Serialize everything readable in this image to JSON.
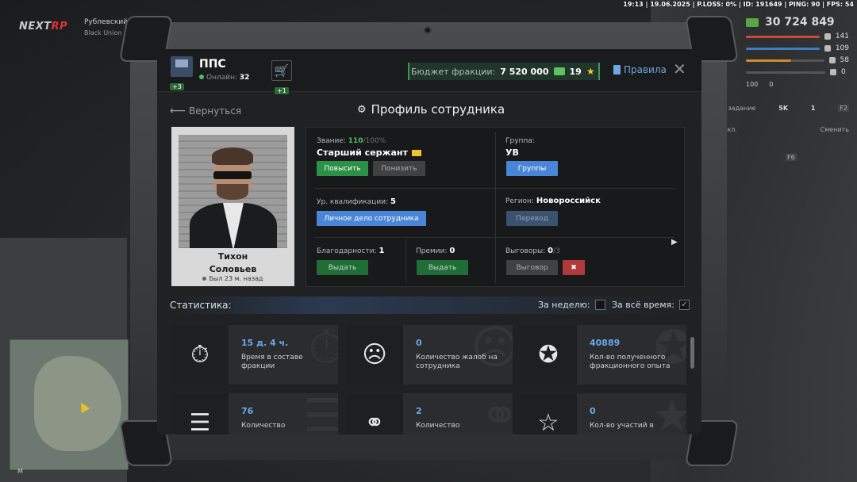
{
  "debug": "19:13 | 19.06.2025 | P.LOSS: 0% | ID: 191649 | PING: 90 | FPS: 54",
  "logo": {
    "main": "NEXT",
    "accent": "RP"
  },
  "location": {
    "district": "Рублевский",
    "street": "Black Union"
  },
  "hud": {
    "money": "30 724 849",
    "bars": [
      {
        "value": "141",
        "percent": 100,
        "color": "#c74a3c"
      },
      {
        "value": "109",
        "percent": 100,
        "color": "#3e7dc4"
      },
      {
        "value": "58",
        "percent": 58,
        "color": "#d38a2f"
      },
      {
        "value": "0",
        "percent": 0,
        "color": "#888888"
      }
    ],
    "extra_left": "100",
    "extra_right": "0",
    "task": "е задание",
    "cash_small": "5K",
    "coins_small": "1",
    "key_f2": "F2",
    "off_label": "ыкл.",
    "change_label": "Сменить",
    "key_f6": "F6"
  },
  "map_label": "M",
  "header": {
    "org_name": "ППС",
    "org_badge": "+3",
    "online_label": "Онлайн:",
    "online_count": "32",
    "cart_badge": "+1",
    "budget_label": "Бюджет фракции:",
    "budget_value": "7 520 000",
    "stars_value": "19",
    "rules_label": "Правила",
    "close_icon": "✕"
  },
  "nav": {
    "back_label": "Вернуться",
    "title": "Профиль сотрудника"
  },
  "profile": {
    "first_name": "Тихон",
    "last_name": "Соловьев",
    "last_seen": "Был 23 м. назад"
  },
  "info": {
    "rank_label": "Звание:",
    "rank_current": "110",
    "rank_max": "/100%",
    "rank_name": "Старший сержант",
    "btn_promote": "Повысить",
    "btn_demote": "Понизить",
    "group_label": "Группа:",
    "group_value": "УВ",
    "btn_groups": "Группы",
    "qual_label": "Ур. квалификации:",
    "qual_value": "5",
    "btn_personal_file": "Личное дело сотрудника",
    "region_label": "Регион:",
    "region_value": "Новороссийск",
    "btn_transfer": "Перевод",
    "thanks_label": "Благодарности:",
    "thanks_value": "1",
    "btn_give_thanks": "Выдать",
    "bonus_label": "Премии:",
    "bonus_value": "0",
    "btn_give_bonus": "Выдать",
    "reprimand_label": "Выговоры:",
    "reprimand_value": "0",
    "reprimand_max": "/3",
    "btn_reprimand": "Выговор"
  },
  "stats": {
    "heading": "Статистика:",
    "week_label": "За неделю:",
    "week_checked": false,
    "alltime_label": "За всё время:",
    "alltime_checked": true,
    "cards": [
      {
        "value": "15 д. 4 ч.",
        "label": "Время в составе фракции",
        "icon": "stopwatch-icon"
      },
      {
        "value": "0",
        "label": "Количество жалоб на сотрудника",
        "icon": "complaint-icon"
      },
      {
        "value": "40889",
        "label": "Кол-во полученного фракционного опыта",
        "icon": "exp-icon"
      },
      {
        "value": "76",
        "label": "Количество",
        "icon": "clipboard-icon"
      },
      {
        "value": "2",
        "label": "Количество",
        "icon": "handcuffs-icon"
      },
      {
        "value": "0",
        "label": "Кол-во участий в",
        "icon": "star-icon"
      }
    ]
  },
  "colors": {
    "accent_blue": "#6aa8ea",
    "green": "#2c9146",
    "budget_bg": "#22352a"
  }
}
